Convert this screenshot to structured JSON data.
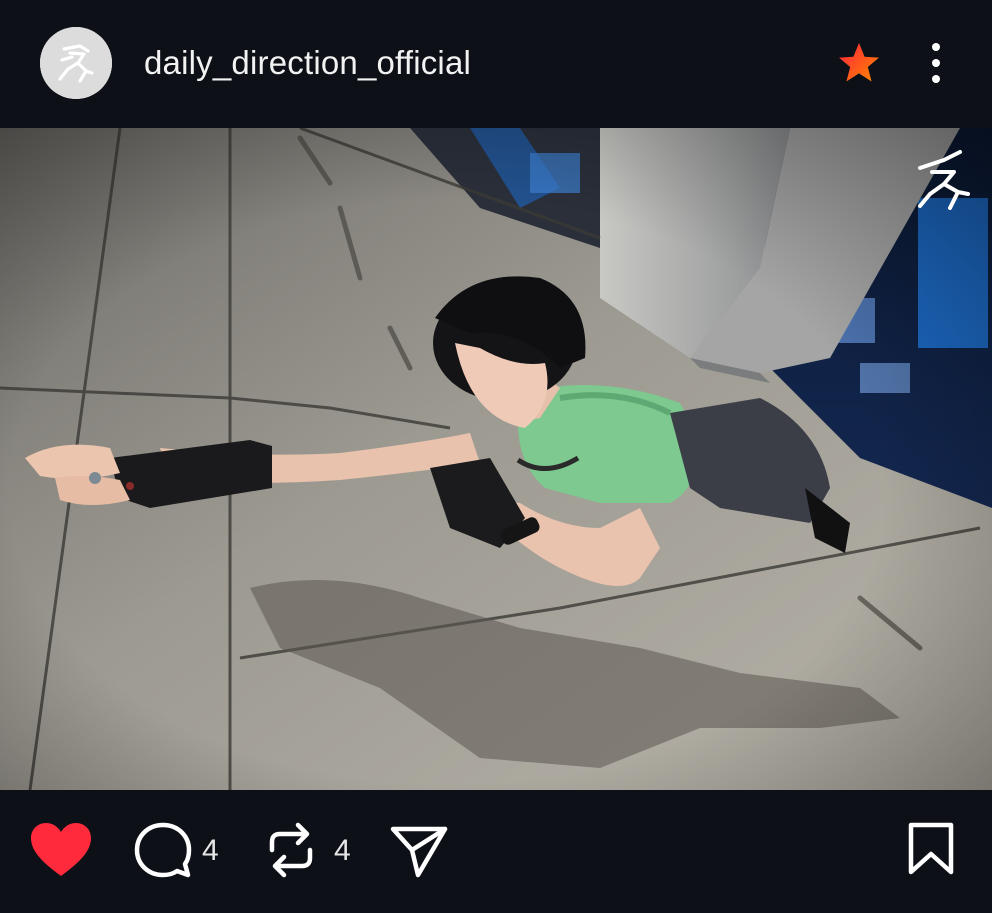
{
  "header": {
    "username": "daily_direction_official",
    "avatar_icon": "runner-logo-icon",
    "favorite_icon": "star-icon",
    "favorite_colors": [
      "#ff1f3d",
      "#ff8a00"
    ],
    "more_icon": "more-vertical-icon"
  },
  "photo": {
    "watermark_icon": "runner-logo-icon"
  },
  "actions": {
    "like_icon": "heart-icon",
    "like_color": "#ff2a3c",
    "liked": true,
    "comment_icon": "comment-icon",
    "comment_count": "4",
    "repost_icon": "repost-icon",
    "repost_count": "4",
    "share_icon": "send-icon",
    "bookmark_icon": "bookmark-icon"
  }
}
